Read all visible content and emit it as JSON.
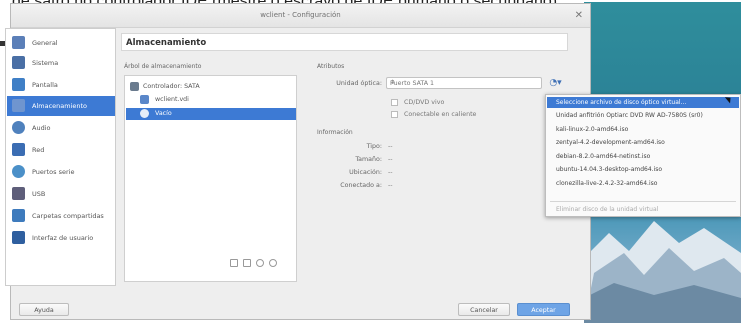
{
  "caption": "de satro no controlador IDE (mestre o escravo de IDE primario o secundario),",
  "window": {
    "title": "wclient - Configuración"
  },
  "nav": {
    "items": [
      {
        "label": "General",
        "color": "#5b7fb8"
      },
      {
        "label": "Sistema",
        "color": "#4a6fa5"
      },
      {
        "label": "Pantalla",
        "color": "#3f7fc6"
      },
      {
        "label": "Almacenamiento",
        "color": "#6f95cf"
      },
      {
        "label": "Audio",
        "color": "#4f81bd"
      },
      {
        "label": "Red",
        "color": "#3b6db3"
      },
      {
        "label": "Puertos serie",
        "color": "#4b90c8"
      },
      {
        "label": "USB",
        "color": "#5e5e7a"
      },
      {
        "label": "Carpetas compartidas",
        "color": "#3e7bbd"
      },
      {
        "label": "Interfaz de usuario",
        "color": "#2f5f9f"
      }
    ],
    "active_index": 3
  },
  "header": {
    "title": "Almacenamiento"
  },
  "tree": {
    "label": "Árbol de almacenamiento",
    "rows": [
      {
        "label": "Controlador: SATA",
        "indent": 0
      },
      {
        "label": "wclient.vdi",
        "indent": 1
      },
      {
        "label": "Vacío",
        "indent": 1,
        "selected": true
      }
    ]
  },
  "attributes": {
    "label": "Atributos",
    "optical_drive_label": "Unidad óptica:",
    "optical_drive_value": "Puerto SATA 1",
    "live_cd_label": "CD/DVD vivo",
    "hotplug_label": "Conectable en caliente"
  },
  "info": {
    "label": "Información",
    "type_label": "Tipo:",
    "type_value": "--",
    "size_label": "Tamaño:",
    "size_value": "--",
    "location_label": "Ubicación:",
    "location_value": "--",
    "attached_label": "Conectado a:",
    "attached_value": "--"
  },
  "menu": {
    "items": [
      {
        "label": "Seleccione archivo de disco óptico virtual...",
        "highlighted": true
      },
      {
        "label": "Unidad anfitrión Optiarc DVD RW AD-7580S (sr0)"
      },
      {
        "label": "kali-linux-2.0-amd64.iso"
      },
      {
        "label": "zentyal-4.2-development-amd64.iso"
      },
      {
        "label": "debian-8.2.0-amd64-netinst.iso"
      },
      {
        "label": "ubuntu-14.04.3-desktop-amd64.iso"
      },
      {
        "label": "clonezilla-live-2.4.2-32-amd64.iso"
      }
    ],
    "remove_label": "Eliminar disco de la unidad virtual"
  },
  "buttons": {
    "help": "Ayuda",
    "cancel": "Cancelar",
    "accept": "Aceptar"
  }
}
